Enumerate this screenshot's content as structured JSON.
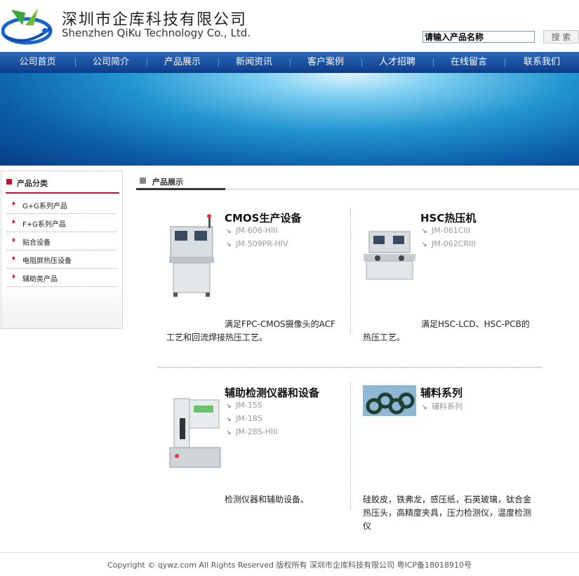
{
  "header": {
    "company_cn": "深圳市企库科技有限公司",
    "company_en": "Shenzhen QiKu Technology Co., Ltd.",
    "search_value": "请输入产品名称",
    "search_button": "搜 索"
  },
  "nav": {
    "items": [
      "公司首页",
      "公司简介",
      "产品展示",
      "新闻资讯",
      "客户案例",
      "人才招聘",
      "在线留言",
      "联系我们"
    ]
  },
  "sidebar": {
    "title": "产品分类",
    "items": [
      "G+G系列产品",
      "F+G系列产品",
      "贴合设备",
      "电阻屏热压设备",
      "辅助类产品"
    ]
  },
  "main": {
    "title": "产品展示",
    "products": [
      {
        "title": "CMOS生产设备",
        "subs": [
          "JM-606-HIII",
          "JM-509PR-HIV"
        ],
        "desc_line1": "满足FPC-CMOS摄像头的ACF",
        "desc_line2": "工艺和回流焊接热压工艺。"
      },
      {
        "title": "HSC热压机",
        "subs": [
          "JM-061CIII",
          "JM-062CRIII"
        ],
        "desc_line1": "满足HSC-LCD、HSC-PCB的",
        "desc_line2": "热压工艺。"
      },
      {
        "title": "辅助检测仪器和设备",
        "subs": [
          "JM-15S",
          "JM-18S",
          "JM-28S-HIII"
        ],
        "desc_line1": "检测仪器和辅助设备。"
      },
      {
        "title": "辅料系列",
        "subs": [
          "辅料系列"
        ],
        "desc_line1": "硅胶皮，铁弗龙，感压纸，石英玻璃，钛合金",
        "desc_line2": "热压头，高精度夹具，压力检测仪，温度检测",
        "desc_line3": "仪"
      }
    ]
  },
  "footer": {
    "text": "Copyright © qywz.com All Rights Reserved   版权所有  深圳市企库科技有限公司  粤ICP备18018910号"
  },
  "colors": {
    "nav_bg": "#1a4fa0",
    "accent_red": "#c8102e"
  }
}
